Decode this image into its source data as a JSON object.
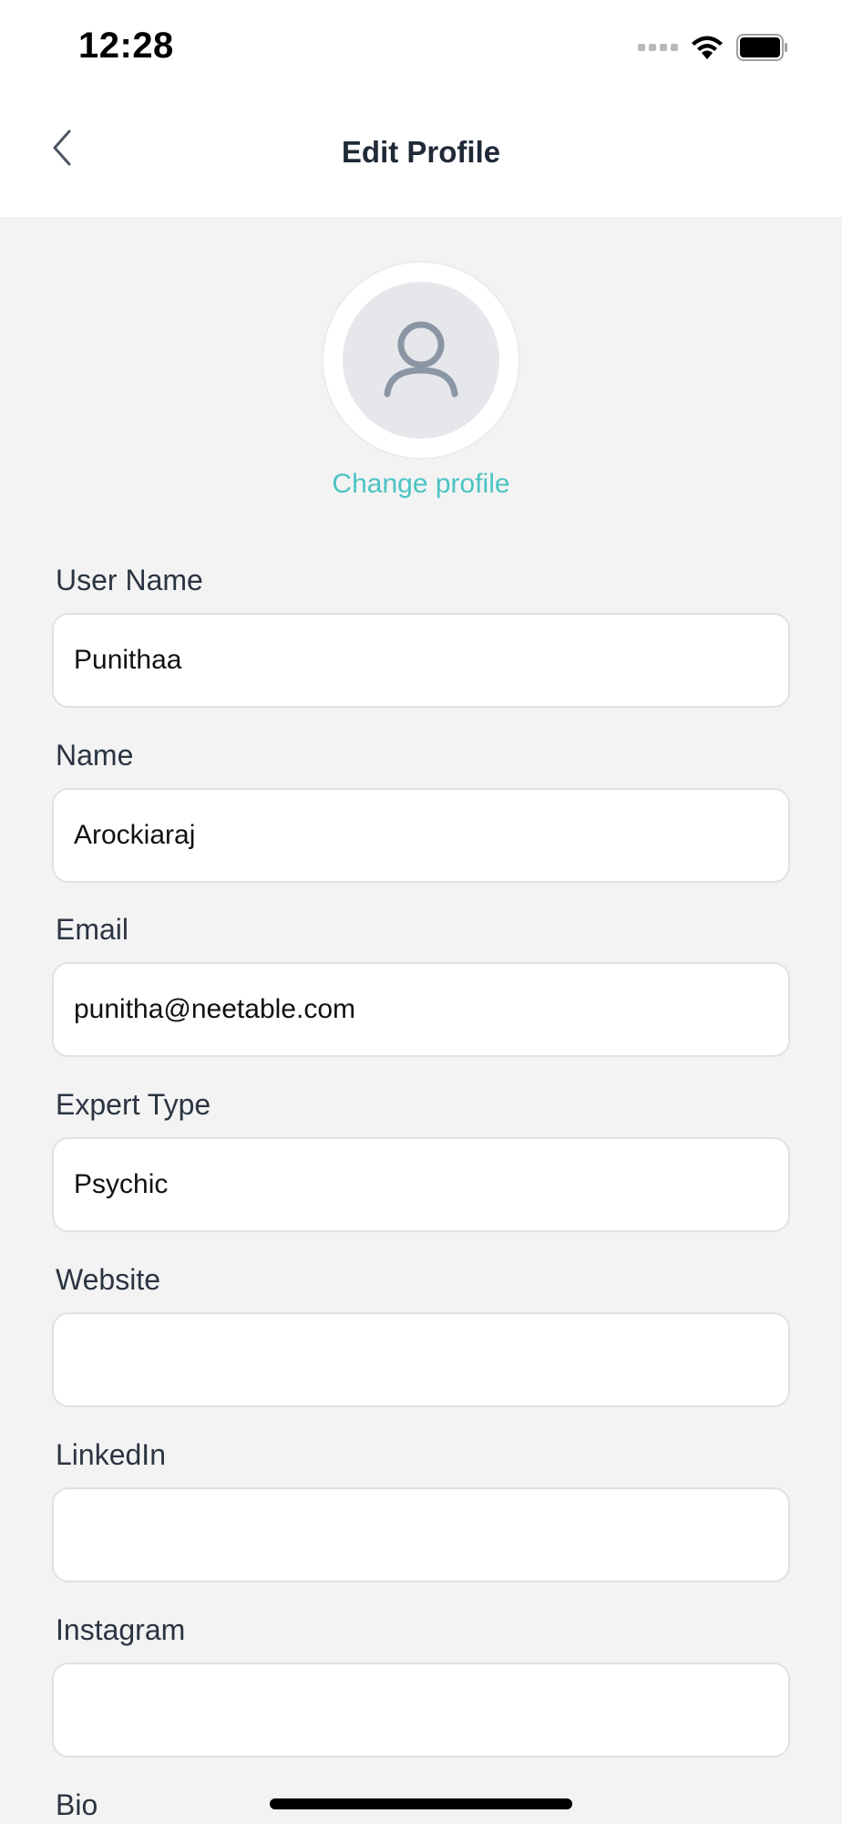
{
  "status_bar": {
    "time": "12:28"
  },
  "header": {
    "title": "Edit Profile",
    "back_icon": "chevron-left-icon"
  },
  "profile": {
    "avatar_icon": "user-icon",
    "change_label": "Change profile"
  },
  "form": {
    "fields": [
      {
        "label": "User Name",
        "value": "Punithaa"
      },
      {
        "label": "Name",
        "value": "Arockiaraj"
      },
      {
        "label": "Email",
        "value": "punitha@neetable.com"
      },
      {
        "label": "Expert Type",
        "value": "Psychic"
      },
      {
        "label": "Website",
        "value": ""
      },
      {
        "label": "LinkedIn",
        "value": ""
      },
      {
        "label": "Instagram",
        "value": ""
      },
      {
        "label": "Bio",
        "value": ""
      }
    ]
  },
  "colors": {
    "accent": "#4bc4c2",
    "background": "#f3f3f4",
    "header_bg": "#ffffff"
  }
}
